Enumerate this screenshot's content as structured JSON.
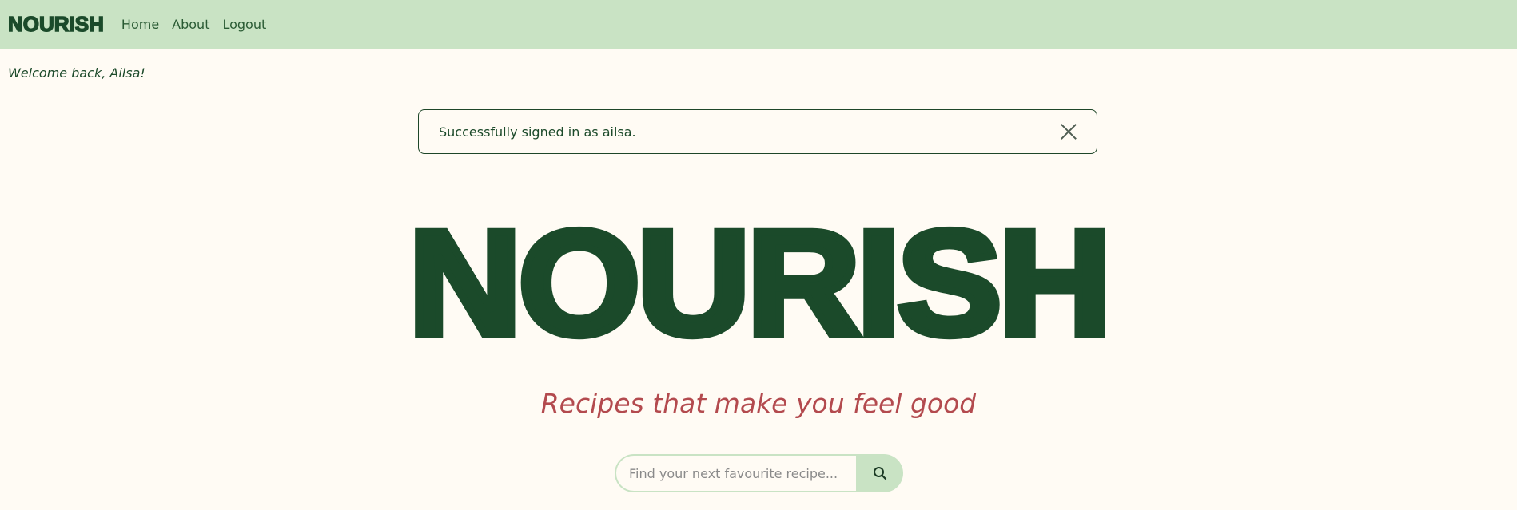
{
  "navbar": {
    "brand": "NOURISH",
    "links": [
      {
        "label": "Home"
      },
      {
        "label": "About"
      },
      {
        "label": "Logout"
      }
    ]
  },
  "welcome": "Welcome back, Ailsa!",
  "alert": {
    "message": "Successfully signed in as ailsa."
  },
  "hero": {
    "title": "NOURISH",
    "tagline": "Recipes that make you feel good"
  },
  "search": {
    "placeholder": "Find your next favourite recipe...",
    "icon": "search-icon"
  },
  "colors": {
    "navbar_bg": "#c9e3c4",
    "brand_green": "#1b4a2a",
    "tagline_red": "#b34a4e",
    "page_bg": "#fffbf4"
  }
}
